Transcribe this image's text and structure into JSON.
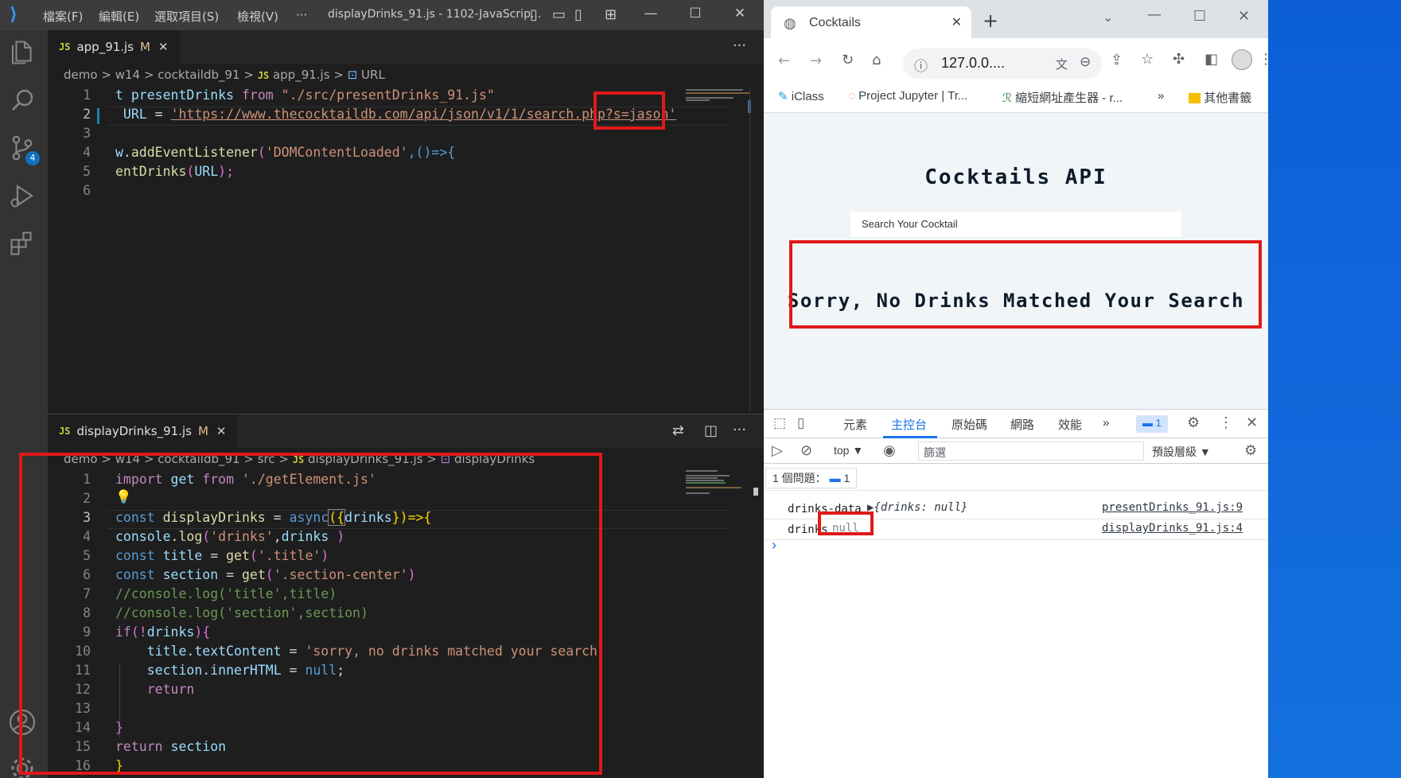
{
  "vscode": {
    "menu": [
      "檔案(F)",
      "編輯(E)",
      "選取項目(S)",
      "檢視(V)",
      "···"
    ],
    "window_title": "displayDrinks_91.js - 1102-JavaScrip...",
    "badge_count": "4",
    "top_editor": {
      "tab": {
        "badge": "JS",
        "name": "app_91.js",
        "modified": "M",
        "close": "✕"
      },
      "breadcrumb": [
        "demo",
        ">",
        "w14",
        ">",
        "cocktaildb_91",
        ">",
        "JS",
        "app_91.js",
        ">",
        "URL"
      ],
      "line_numbers": [
        "1",
        "2",
        "3",
        "4",
        "5",
        "6"
      ],
      "lines": [
        [
          "t presentDrinks ",
          "from",
          " \"./src/presentDrinks_91.js\""
        ],
        [
          " URL",
          " = ",
          "'https://www.thecocktaildb.com/api/json/v1/1/search.php?s=jason'"
        ],
        [
          ""
        ],
        [
          "w.",
          "addEventListener",
          "(",
          "'DOMContentLoaded'",
          ",()=>{"
        ],
        [
          "entDrinks",
          "(",
          "URL",
          ");"
        ],
        [
          ""
        ]
      ]
    },
    "bottom_editor": {
      "tab": {
        "badge": "JS",
        "name": "displayDrinks_91.js",
        "modified": "M",
        "close": "✕"
      },
      "breadcrumb": [
        "demo",
        ">",
        "w14",
        ">",
        "cocktaildb_91",
        ">",
        "src",
        ">",
        "JS",
        "displayDrinks_91.js",
        ">",
        "displayDrinks"
      ],
      "line_numbers": [
        "1",
        "2",
        "3",
        "4",
        "5",
        "6",
        "7",
        "8",
        "9",
        "10",
        "11",
        "12",
        "13",
        "14",
        "15",
        "16"
      ],
      "lines": [
        [
          "import",
          " get ",
          "from",
          " './getElement.js'"
        ],
        [
          "💡"
        ],
        [
          "const",
          " displayDrinks",
          " = ",
          "async",
          "({",
          "drinks",
          "})=>{"
        ],
        [
          "console",
          ".",
          "log",
          "(",
          "'drinks'",
          ",",
          "drinks",
          " )"
        ],
        [
          "const",
          " title",
          " = ",
          "get",
          "(",
          "'.title'",
          ")"
        ],
        [
          "const",
          " section",
          " = ",
          "get",
          "(",
          "'.section-center'",
          ")"
        ],
        [
          "//console.log('title',title)"
        ],
        [
          "//console.log('section',section)"
        ],
        [
          "if",
          "(!",
          "drinks",
          "){"
        ],
        [
          "    title",
          ".",
          "textContent",
          " = ",
          "'sorry, no drinks matched your search'"
        ],
        [
          "    section",
          ".",
          "innerHTML",
          " = ",
          "null",
          ";"
        ],
        [
          "    return"
        ],
        [
          ""
        ],
        [
          "}"
        ],
        [
          "return",
          " section"
        ],
        [
          "}"
        ]
      ]
    }
  },
  "browser": {
    "tab_title": "Cocktails",
    "address": "127.0.0....",
    "bookmarks": [
      "iClass",
      "Project Jupyter | Tr...",
      "縮短網址產生器 - r...",
      "»",
      "其他書籤"
    ],
    "page": {
      "heading": "Cocktails API",
      "search_placeholder": "Search Your Cocktail",
      "message": "Sorry, No Drinks Matched Your Search"
    },
    "devtools": {
      "tabs": [
        "元素",
        "主控台",
        "原始碼",
        "網路",
        "效能",
        "»"
      ],
      "issues_badge": "1",
      "context": "top ▼",
      "filter_placeholder": "篩選",
      "levels": "預設層級 ▼",
      "issues_line": "1 個問題：",
      "issues_count": "1",
      "logs": [
        {
          "label": "drinks-data",
          "value": "▶{drinks: null}",
          "source": "presentDrinks_91.js:9"
        },
        {
          "label": "drinks",
          "value": "null",
          "source": "displayDrinks_91.js:4"
        }
      ],
      "prompt": "›"
    }
  }
}
